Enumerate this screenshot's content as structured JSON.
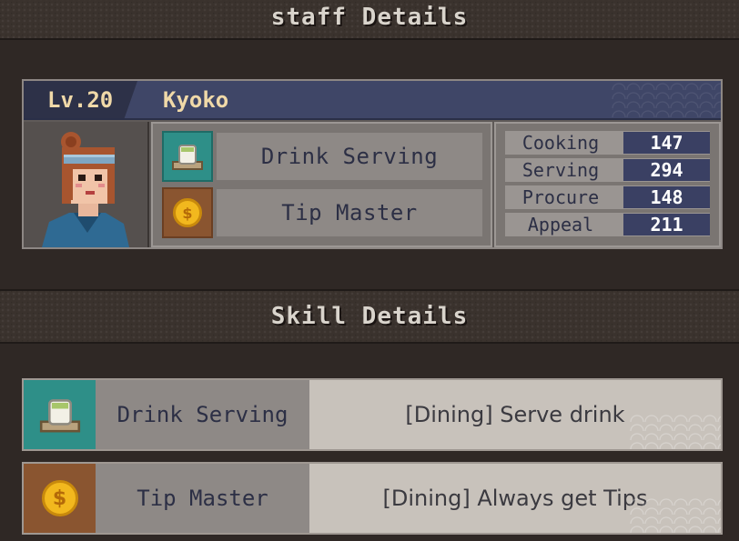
{
  "header": {
    "title": "staff Details"
  },
  "staff": {
    "level": "Lv.20",
    "name": "Kyoko",
    "traits": [
      {
        "label": "Drink Serving",
        "icon": "tea-cup-icon"
      },
      {
        "label": "Tip Master",
        "icon": "coin-icon"
      }
    ],
    "stats": [
      {
        "name": "Cooking",
        "value": "147"
      },
      {
        "name": "Serving",
        "value": "294"
      },
      {
        "name": "Procure",
        "value": "148"
      },
      {
        "name": "Appeal",
        "value": "211"
      }
    ]
  },
  "skills_section": {
    "title": "Skill Details"
  },
  "skills": [
    {
      "name": "Drink Serving",
      "description": "[Dining] Serve drink",
      "icon": "tea-cup-icon"
    },
    {
      "name": "Tip Master",
      "description": "[Dining] Always get Tips",
      "icon": "coin-icon",
      "coin_symbol": "$"
    }
  ],
  "colors": {
    "header_bar": "#3f4667",
    "stat_value_bg": "#3a4063",
    "teal_icon_bg": "#2e8f88",
    "orange_icon_bg": "#8a5530",
    "gold_text": "#f0d9a8"
  }
}
